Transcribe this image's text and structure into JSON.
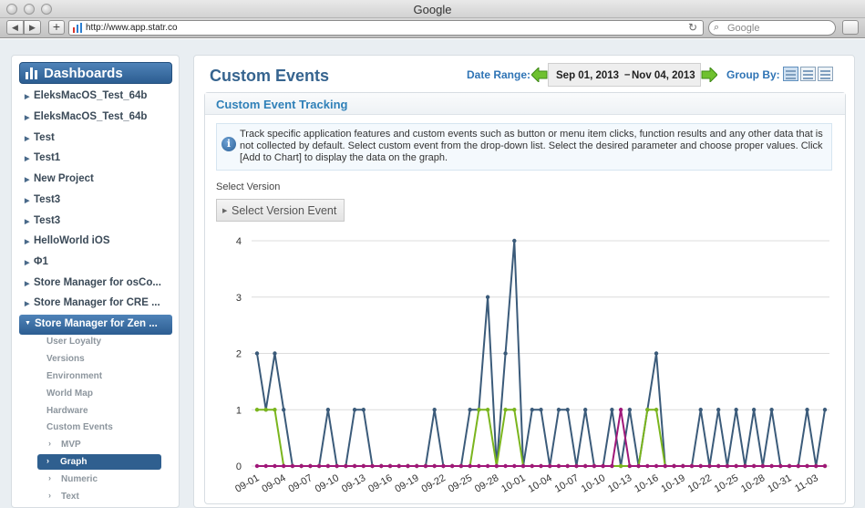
{
  "window": {
    "title": "Google"
  },
  "toolbar": {
    "back_icon": "back-arrow-icon",
    "forward_icon": "forward-arrow-icon",
    "url": "http://www.app.statr.co",
    "search_placeholder": "Google"
  },
  "sidebar": {
    "header": "Dashboards",
    "items": [
      {
        "label": "EleksMacOS_Test_64b"
      },
      {
        "label": "EleksMacOS_Test_64b"
      },
      {
        "label": "Test"
      },
      {
        "label": "Test1"
      },
      {
        "label": "New Project"
      },
      {
        "label": "Test3"
      },
      {
        "label": "Test3"
      },
      {
        "label": "HelloWorld iOS"
      },
      {
        "label": "Φ1"
      },
      {
        "label": "Store Manager for osCo..."
      },
      {
        "label": "Store Manager for CRE ..."
      }
    ],
    "active_item": "Store Manager for Zen ...",
    "subitems": [
      {
        "label": "User Loyalty"
      },
      {
        "label": "Versions"
      },
      {
        "label": "Environment"
      },
      {
        "label": "World Map"
      },
      {
        "label": "Hardware"
      },
      {
        "label": "Custom Events"
      }
    ],
    "custom_event_children": [
      {
        "label": "MVP"
      },
      {
        "label": "Graph"
      },
      {
        "label": "Numeric"
      },
      {
        "label": "Text"
      }
    ],
    "active_child": "Graph"
  },
  "main": {
    "title": "Custom Events",
    "date_range_label": "Date Range:",
    "date_from": "Sep 01, 2013",
    "date_separator": "–",
    "date_to": "Nov 04, 2013",
    "group_by_label": "Group By:",
    "section_title": "Custom Event Tracking",
    "info_text": "Track specific application features and custom events such as button or menu item clicks, function results and any other data that is not collected by default. Select custom event from the drop-down list. Select the desired parameter and choose proper values. Click [Add to Chart] to display the data on the graph.",
    "select_version_label": "Select Version",
    "select_version_button": "Select Version Event"
  },
  "chart_data": {
    "type": "line",
    "ylim": [
      0,
      4
    ],
    "y_ticks": [
      0,
      1,
      2,
      3,
      4
    ],
    "x_tick_labels": [
      "09-01",
      "09-04",
      "09-07",
      "09-10",
      "09-13",
      "09-16",
      "09-19",
      "09-22",
      "09-25",
      "09-28",
      "10-01",
      "10-04",
      "10-07",
      "10-10",
      "10-13",
      "10-16",
      "10-19",
      "10-22",
      "10-25",
      "10-28",
      "10-31",
      "11-03"
    ],
    "colors": {
      "blue": "#3b5b7a",
      "green": "#7ab51d",
      "magenta": "#a01779",
      "grid": "#dcdcdc"
    },
    "series": [
      {
        "color": "blue",
        "values": [
          2,
          1,
          2,
          1,
          0,
          0,
          0,
          0,
          1,
          0,
          0,
          1,
          1,
          0,
          0,
          0,
          0,
          0,
          0,
          0,
          1,
          0,
          0,
          0,
          1,
          1,
          3,
          0,
          2,
          4,
          0,
          1,
          1,
          0,
          1,
          1,
          0,
          1,
          0,
          0,
          1,
          0,
          1,
          0,
          1,
          2,
          0,
          0,
          0,
          0,
          1,
          0,
          1,
          0,
          1,
          0,
          1,
          0,
          1,
          0,
          0,
          0,
          1,
          0,
          1
        ]
      },
      {
        "color": "green",
        "values": [
          1,
          1,
          1,
          0,
          0,
          0,
          0,
          0,
          0,
          0,
          0,
          0,
          0,
          0,
          0,
          0,
          0,
          0,
          0,
          0,
          0,
          0,
          0,
          0,
          0,
          1,
          1,
          0,
          1,
          1,
          0,
          0,
          0,
          0,
          0,
          0,
          0,
          0,
          0,
          0,
          0,
          0,
          0,
          0,
          1,
          1,
          0,
          0,
          0,
          0,
          0,
          0,
          0,
          0,
          0,
          0,
          0,
          0,
          0,
          0,
          0,
          0,
          0,
          0,
          0
        ]
      },
      {
        "color": "magenta",
        "values": [
          0,
          0,
          0,
          0,
          0,
          0,
          0,
          0,
          0,
          0,
          0,
          0,
          0,
          0,
          0,
          0,
          0,
          0,
          0,
          0,
          0,
          0,
          0,
          0,
          0,
          0,
          0,
          0,
          0,
          0,
          0,
          0,
          0,
          0,
          0,
          0,
          0,
          0,
          0,
          0,
          0,
          1,
          0,
          0,
          0,
          0,
          0,
          0,
          0,
          0,
          0,
          0,
          0,
          0,
          0,
          0,
          0,
          0,
          0,
          0,
          0,
          0,
          0,
          0,
          0
        ]
      }
    ]
  }
}
